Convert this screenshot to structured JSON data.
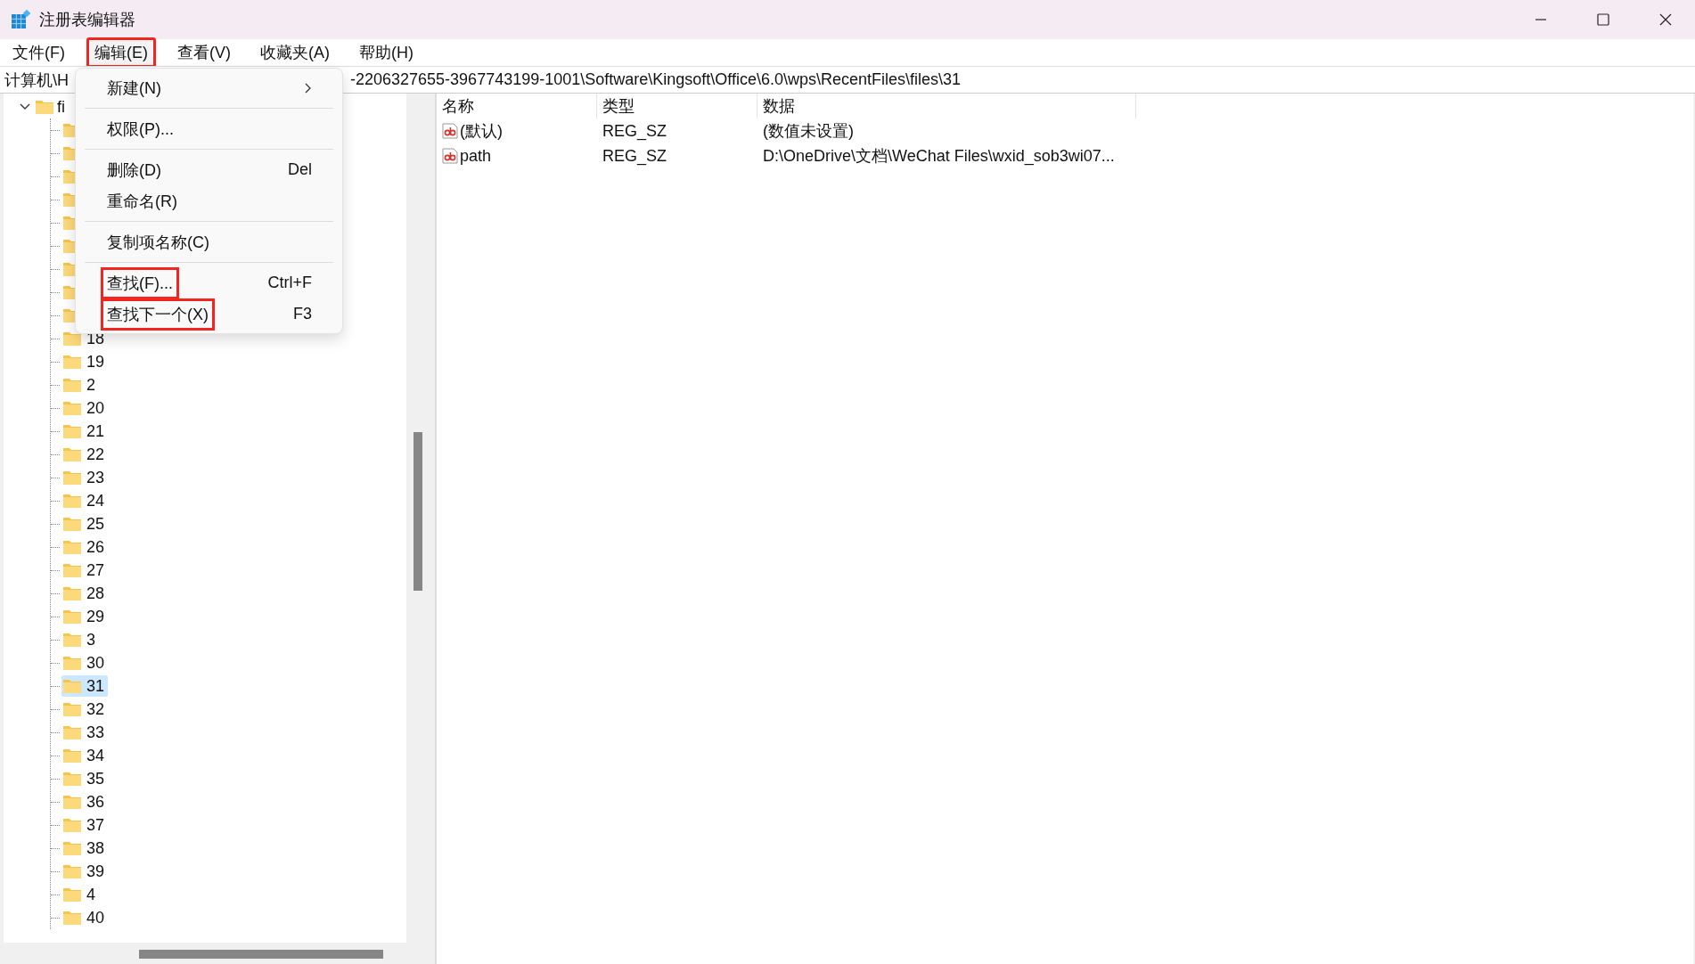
{
  "window": {
    "title": "注册表编辑器"
  },
  "menu_bar": [
    {
      "label": "文件(F)",
      "highlighted": false
    },
    {
      "label": "编辑(E)",
      "highlighted": true
    },
    {
      "label": "查看(V)",
      "highlighted": false
    },
    {
      "label": "收藏夹(A)",
      "highlighted": false
    },
    {
      "label": "帮助(H)",
      "highlighted": false
    }
  ],
  "address_bar": {
    "start": "计算机\\H",
    "end": "-2206327655-3967743199-1001\\Software\\Kingsoft\\Office\\6.0\\wps\\RecentFiles\\files\\31"
  },
  "tree": {
    "root": {
      "label": "fi",
      "expanded": true
    },
    "children": [
      {
        "selected": false
      },
      {
        "selected": false
      },
      {
        "selected": false
      },
      {
        "selected": false
      },
      {
        "selected": false
      },
      {
        "selected": false
      },
      {
        "selected": false
      },
      {
        "selected": false
      },
      {
        "selected": false
      },
      {
        "label": "18",
        "selected": false
      },
      {
        "label": "19",
        "selected": false
      },
      {
        "label": "2",
        "selected": false
      },
      {
        "label": "20",
        "selected": false
      },
      {
        "label": "21",
        "selected": false
      },
      {
        "label": "22",
        "selected": false
      },
      {
        "label": "23",
        "selected": false
      },
      {
        "label": "24",
        "selected": false
      },
      {
        "label": "25",
        "selected": false
      },
      {
        "label": "26",
        "selected": false
      },
      {
        "label": "27",
        "selected": false
      },
      {
        "label": "28",
        "selected": false
      },
      {
        "label": "29",
        "selected": false
      },
      {
        "label": "3",
        "selected": false
      },
      {
        "label": "30",
        "selected": false
      },
      {
        "label": "31",
        "selected": true
      },
      {
        "label": "32",
        "selected": false
      },
      {
        "label": "33",
        "selected": false
      },
      {
        "label": "34",
        "selected": false
      },
      {
        "label": "35",
        "selected": false
      },
      {
        "label": "36",
        "selected": false
      },
      {
        "label": "37",
        "selected": false
      },
      {
        "label": "38",
        "selected": false
      },
      {
        "label": "39",
        "selected": false
      },
      {
        "label": "4",
        "selected": false
      },
      {
        "label": "40",
        "selected": false
      }
    ]
  },
  "values_table": {
    "columns": [
      "名称",
      "类型",
      "数据"
    ],
    "rows": [
      {
        "name": "(默认)",
        "type": "REG_SZ",
        "data": "(数值未设置)"
      },
      {
        "name": "path",
        "type": "REG_SZ",
        "data": "D:\\OneDrive\\文档\\WeChat Files\\wxid_sob3wi07..."
      }
    ]
  },
  "context_menu": [
    {
      "kind": "item",
      "label": "新建(N)",
      "submenu": true,
      "highlighted": false
    },
    {
      "kind": "separator"
    },
    {
      "kind": "item",
      "label": "权限(P)...",
      "submenu": false,
      "highlighted": false
    },
    {
      "kind": "separator"
    },
    {
      "kind": "item",
      "label": "删除(D)",
      "shortcut": "Del",
      "submenu": false,
      "highlighted": false
    },
    {
      "kind": "item",
      "label": "重命名(R)",
      "submenu": false,
      "highlighted": false
    },
    {
      "kind": "separator"
    },
    {
      "kind": "item",
      "label": "复制项名称(C)",
      "submenu": false,
      "highlighted": false
    },
    {
      "kind": "separator"
    },
    {
      "kind": "item",
      "label": "查找(F)...",
      "shortcut": "Ctrl+F",
      "submenu": false,
      "highlighted": true
    },
    {
      "kind": "item",
      "label": "查找下一个(X)",
      "shortcut": "F3",
      "submenu": false,
      "highlighted": true
    }
  ]
}
